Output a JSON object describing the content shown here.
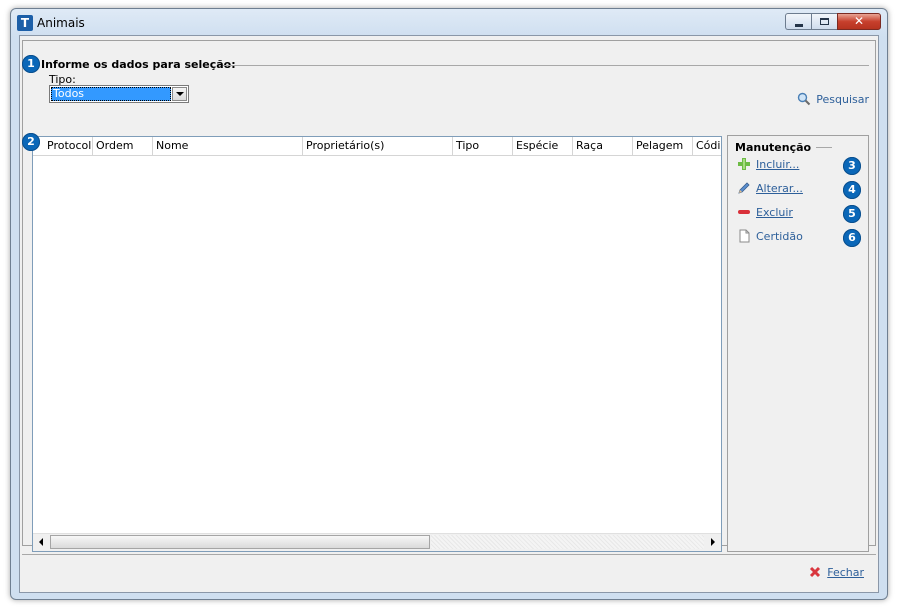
{
  "window": {
    "icon_letter": "T",
    "title": "Animais",
    "close_glyph": "✕"
  },
  "selection": {
    "badge": "1",
    "title": "Informe os dados para seleção:",
    "tipo_label": "Tipo:",
    "tipo_value": "Todos",
    "search_label": "Pesquisar"
  },
  "grid": {
    "badge": "2",
    "columns": [
      "Protocolo",
      "Ordem",
      "Nome",
      "Proprietário(s)",
      "Tipo",
      "Espécie",
      "Raça",
      "Pelagem",
      "Códig"
    ]
  },
  "maintenance": {
    "title": "Manutenção",
    "actions": [
      {
        "label": "Incluir...",
        "badge": "3",
        "icon": "plus-icon"
      },
      {
        "label": "Alterar...",
        "badge": "4",
        "icon": "pencil-icon"
      },
      {
        "label": "Excluir",
        "badge": "5",
        "icon": "minus-icon"
      },
      {
        "label": "Certidão",
        "badge": "6",
        "icon": "document-icon"
      }
    ]
  },
  "footer": {
    "close_label": "Fechar"
  },
  "colors": {
    "badge": "#0a67b8",
    "link": "#2d5f9a",
    "selection": "#3399ff"
  }
}
